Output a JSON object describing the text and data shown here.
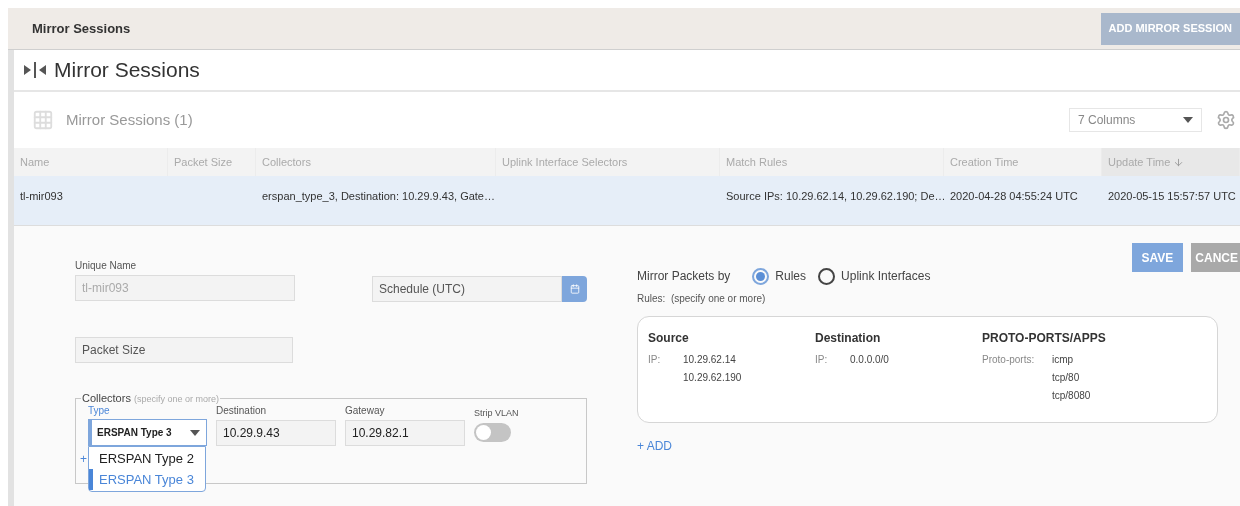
{
  "page_header": {
    "title": "Mirror Sessions",
    "add_button": {
      "label": "ADD MIRROR SESSION",
      "disabled": true
    }
  },
  "panel": {
    "title": "Mirror Sessions"
  },
  "table": {
    "title": "Mirror Sessions (1)",
    "columns_select": "7 Columns",
    "columns": [
      {
        "label": "Name",
        "sorted": false
      },
      {
        "label": "Packet Size",
        "sorted": false
      },
      {
        "label": "Collectors",
        "sorted": false
      },
      {
        "label": "Uplink Interface Selectors",
        "sorted": false
      },
      {
        "label": "Match Rules",
        "sorted": false
      },
      {
        "label": "Creation Time",
        "sorted": false
      },
      {
        "label": "Update Time",
        "sorted": true
      }
    ],
    "rows": [
      {
        "selected": true,
        "cells": [
          "tl-mir093",
          null,
          "erspan_type_3, Destination: 10.29.9.43, Gate…",
          null,
          "Source IPs: 10.29.62.14, 10.29.62.190; De…",
          "2020-04-28 04:55:24 UTC",
          "2020-05-15 15:57:57 UTC"
        ]
      }
    ]
  },
  "form": {
    "unique_name": {
      "label": "Unique Name",
      "value": "tl-mir093",
      "disabled": true
    },
    "schedule": {
      "placeholder": "Schedule (UTC)"
    },
    "packet_size": {
      "placeholder": "Packet Size"
    },
    "collectors": {
      "legend": "Collectors",
      "hint": "(specify one or more)",
      "type_select": {
        "label": "Type",
        "value": "ERSPAN Type 3",
        "open": true,
        "options": [
          {
            "label": "ERSPAN Type 2",
            "selected": false
          },
          {
            "label": "ERSPAN Type 3",
            "selected": true
          }
        ]
      },
      "destination": {
        "label": "Destination",
        "value": "10.29.9.43"
      },
      "gateway": {
        "label": "Gateway",
        "value": "10.29.82.1"
      },
      "strip_vlan": {
        "label": "Strip VLAN",
        "on": false
      },
      "add_link": "+"
    },
    "mirror_by": {
      "label": "Mirror Packets by",
      "options": [
        {
          "label": "Rules",
          "selected": true
        },
        {
          "label": "Uplink Interfaces",
          "selected": false
        }
      ]
    },
    "rules": {
      "label": "Rules:  (specify one or more)",
      "columns": [
        {
          "title": "Source",
          "key": "IP:",
          "values": [
            "10.29.62.14",
            "10.29.62.190"
          ]
        },
        {
          "title": "Destination",
          "key": "IP:",
          "values": [
            "0.0.0.0/0"
          ]
        },
        {
          "title": "PROTO-PORTS/APPS",
          "key": "Proto-ports:",
          "values": [
            "icmp",
            "tcp/80",
            "tcp/8080"
          ]
        }
      ]
    },
    "add_rule": "+ ADD",
    "buttons": [
      {
        "label": "SAVE",
        "kind": "primary"
      },
      {
        "label": "CANCE",
        "kind": "secondary"
      }
    ]
  }
}
